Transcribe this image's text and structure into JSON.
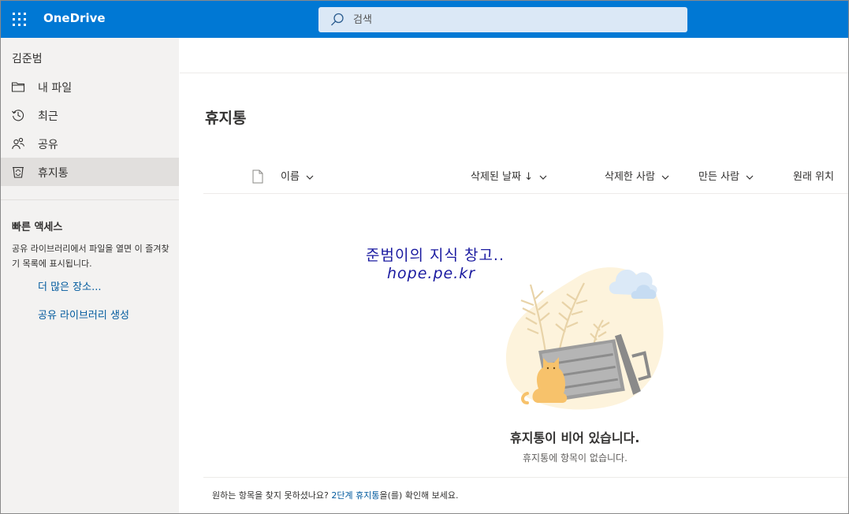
{
  "app": {
    "brand": "OneDrive",
    "accent_color": "#0078d4"
  },
  "search": {
    "placeholder": "검색"
  },
  "sidebar": {
    "user_name": "김준범",
    "items": [
      {
        "label": "내 파일",
        "icon": "folder-icon",
        "active": false
      },
      {
        "label": "최근",
        "icon": "history-icon",
        "active": false
      },
      {
        "label": "공유",
        "icon": "people-icon",
        "active": false
      },
      {
        "label": "휴지통",
        "icon": "recycle-bin-icon",
        "active": true
      }
    ],
    "quick_access": {
      "title": "빠른 액세스",
      "description": "공유 라이브러리에서 파일을 열면 이 즐겨찾기 목록에 표시됩니다.",
      "more_places": "더 많은 장소...",
      "create_library": "공유 라이브러리 생성"
    }
  },
  "main": {
    "title": "휴지통",
    "columns": {
      "name": "이름",
      "deleted_date": "삭제된 날짜 ↓",
      "deleted_by": "삭제한 사람",
      "created_by": "만든 사람",
      "original_location": "원래 위치"
    },
    "empty_state": {
      "title": "휴지통이 비어 있습니다.",
      "subtitle": "휴지통에 항목이 없습니다."
    },
    "footer": {
      "text_before": "원하는 항목을 찾지 못하셨나요? ",
      "link": "2단계 휴지통",
      "text_after": "을(를) 확인해 보세요."
    }
  },
  "watermark": {
    "line1": "준범이의 지식 창고..",
    "line2": "hope.pe.kr"
  }
}
